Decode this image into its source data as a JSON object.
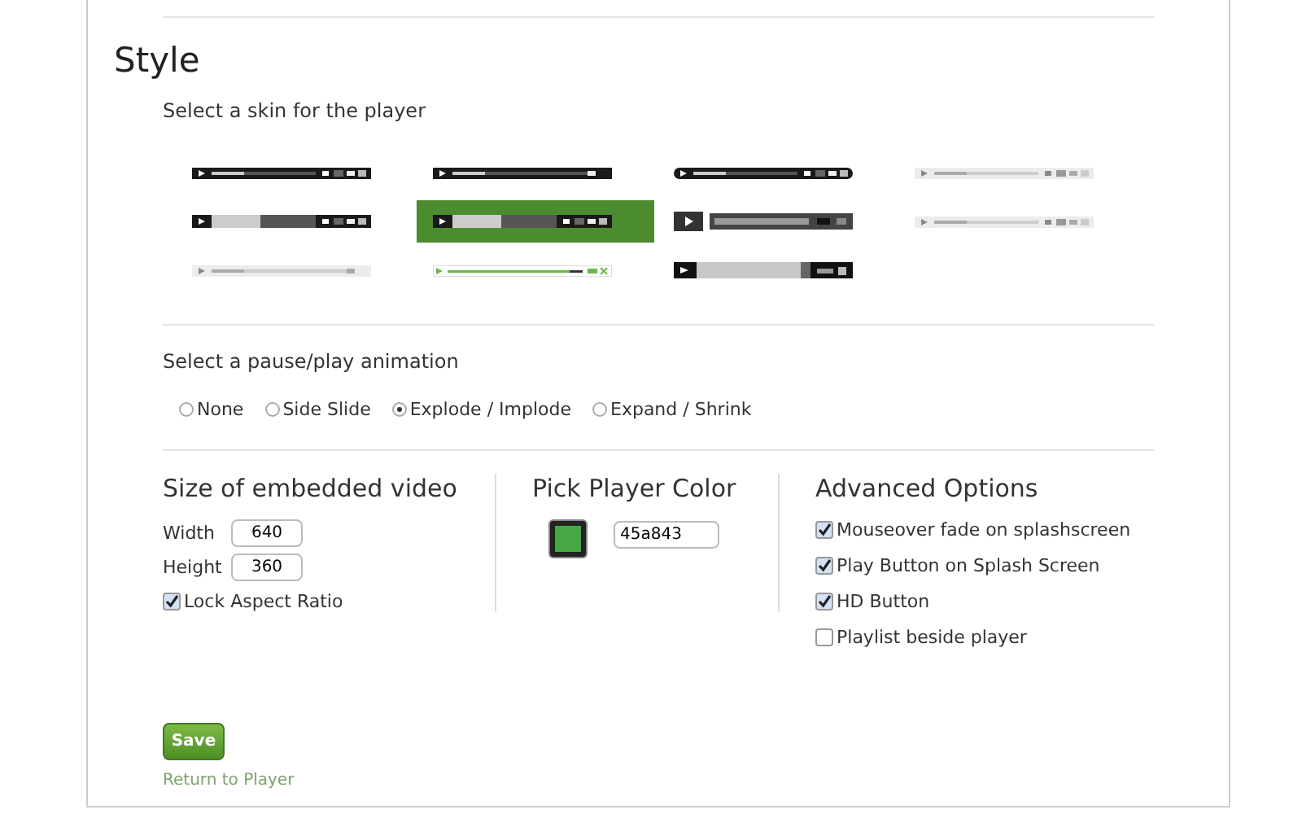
{
  "section_title": "Style",
  "skin_prompt": "Select a skin for the player",
  "skins": [
    {
      "kind": "dark",
      "selected": false
    },
    {
      "kind": "dark-slim",
      "selected": false
    },
    {
      "kind": "rounded",
      "selected": false
    },
    {
      "kind": "light",
      "selected": false
    },
    {
      "kind": "dark-thick",
      "selected": false
    },
    {
      "kind": "dark-thick",
      "selected": true
    },
    {
      "kind": "split",
      "selected": false
    },
    {
      "kind": "light",
      "selected": false
    },
    {
      "kind": "light-slim",
      "selected": false
    },
    {
      "kind": "green",
      "selected": false
    },
    {
      "kind": "tall",
      "selected": false
    }
  ],
  "animation_prompt": "Select a pause/play animation",
  "animations": [
    {
      "label": "None",
      "selected": false
    },
    {
      "label": "Side Slide",
      "selected": false
    },
    {
      "label": "Explode / Implode",
      "selected": true
    },
    {
      "label": "Expand / Shrink",
      "selected": false
    }
  ],
  "size": {
    "title": "Size of embedded video",
    "fields": [
      {
        "label": "Width",
        "value": "640"
      },
      {
        "label": "Height",
        "value": "360"
      }
    ],
    "lock": {
      "label": "Lock Aspect Ratio",
      "checked": true
    }
  },
  "color": {
    "title": "Pick Player Color",
    "value": "45a843"
  },
  "advanced": {
    "title": "Advanced Options",
    "options": [
      {
        "label": "Mouseover fade on splashscreen",
        "checked": true
      },
      {
        "label": "Play Button on Splash Screen",
        "checked": true
      },
      {
        "label": "HD Button",
        "checked": true
      },
      {
        "label": "Playlist beside player",
        "checked": false
      }
    ]
  },
  "save_button": "Save",
  "return_link": "Return to Player"
}
